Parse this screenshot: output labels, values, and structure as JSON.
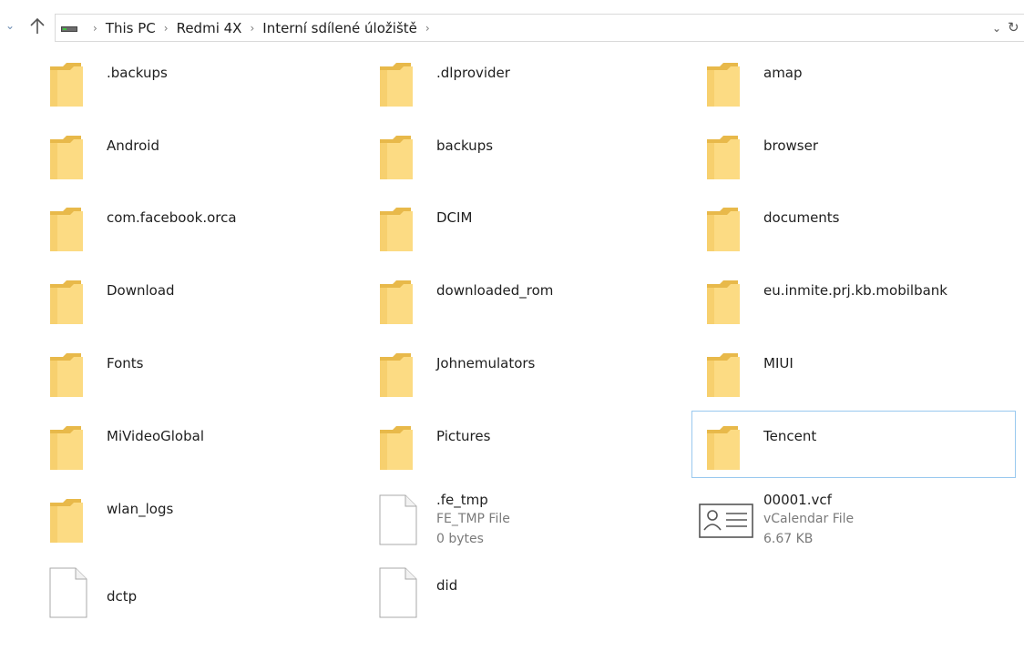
{
  "breadcrumb": [
    "This PC",
    "Redmi 4X",
    "Interní sdílené úložiště"
  ],
  "items": [
    {
      "kind": "folder",
      "name": ".backups"
    },
    {
      "kind": "folder",
      "name": ".dlprovider"
    },
    {
      "kind": "folder",
      "name": "amap"
    },
    {
      "kind": "folder",
      "name": "Android"
    },
    {
      "kind": "folder",
      "name": "backups"
    },
    {
      "kind": "folder",
      "name": "browser"
    },
    {
      "kind": "folder",
      "name": "com.facebook.orca"
    },
    {
      "kind": "folder",
      "name": "DCIM"
    },
    {
      "kind": "folder",
      "name": "documents"
    },
    {
      "kind": "folder",
      "name": "Download"
    },
    {
      "kind": "folder",
      "name": "downloaded_rom"
    },
    {
      "kind": "folder",
      "name": "eu.inmite.prj.kb.mobilbank"
    },
    {
      "kind": "folder",
      "name": "Fonts"
    },
    {
      "kind": "folder",
      "name": "Johnemulators"
    },
    {
      "kind": "folder",
      "name": "MIUI"
    },
    {
      "kind": "folder",
      "name": "MiVideoGlobal"
    },
    {
      "kind": "folder",
      "name": "Pictures"
    },
    {
      "kind": "folder",
      "name": "Tencent",
      "selected": true
    },
    {
      "kind": "folder",
      "name": "wlan_logs"
    },
    {
      "kind": "file",
      "name": ".fe_tmp",
      "type": "FE_TMP File",
      "size": "0 bytes"
    },
    {
      "kind": "contact",
      "name": "00001.vcf",
      "type": "vCalendar File",
      "size": "6.67 KB"
    },
    {
      "kind": "file-plain",
      "name": "dctp"
    },
    {
      "kind": "file-plain",
      "name": "did"
    }
  ],
  "colors": {
    "folder_back": "#e8b94a",
    "folder_front": "#fcdb83",
    "selection_border": "#99c9ef",
    "secondary_text": "#7a7a7a"
  }
}
